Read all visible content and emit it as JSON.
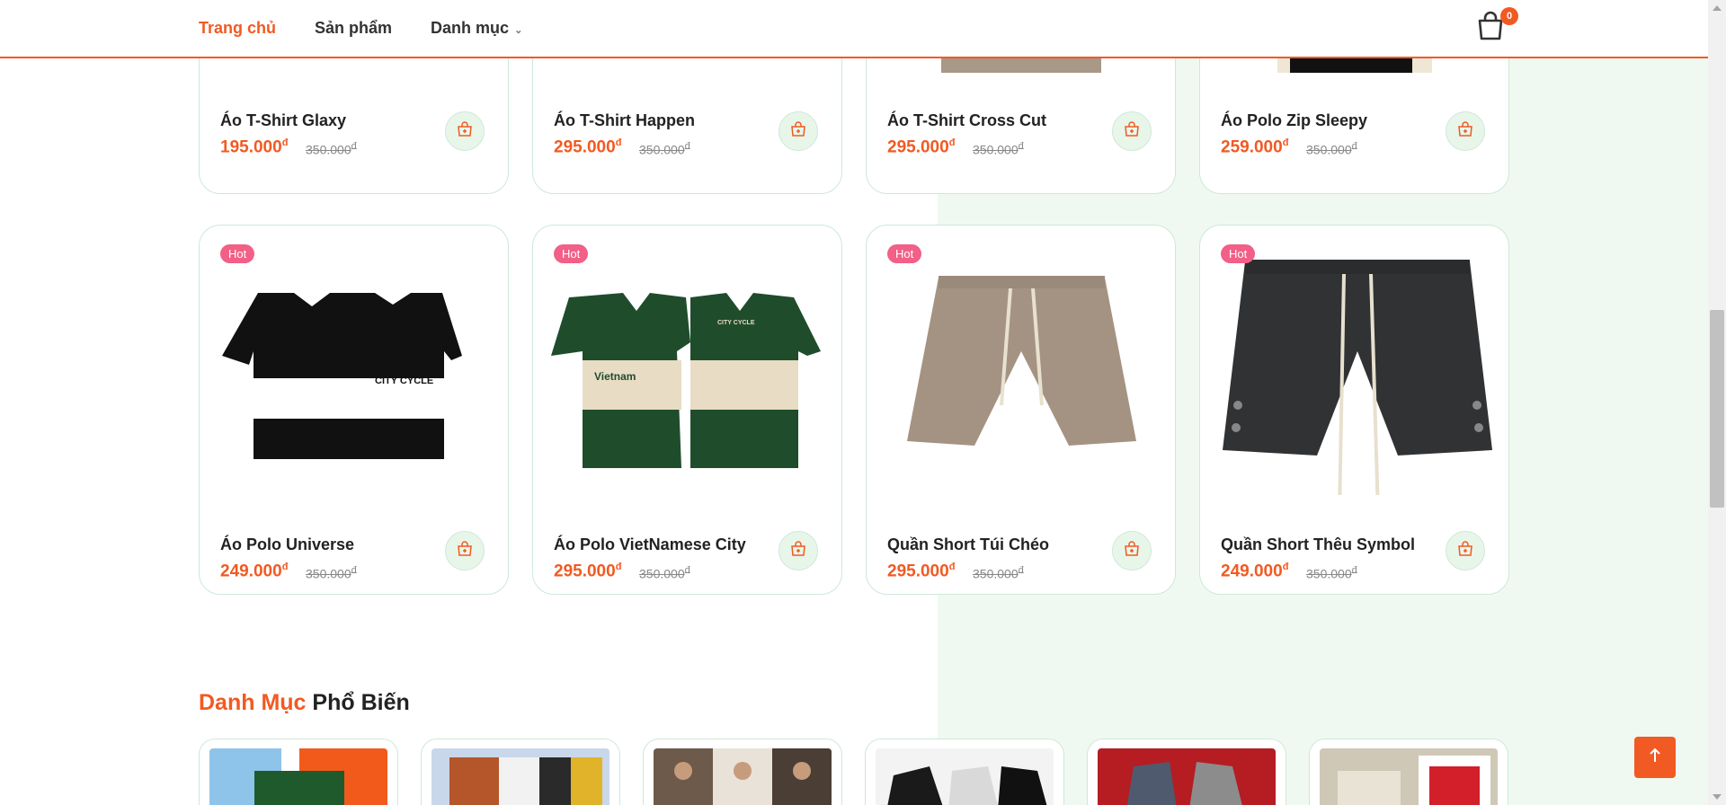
{
  "nav": {
    "items": [
      {
        "label": "Trang chủ",
        "active": true
      },
      {
        "label": "Sản phẩm",
        "active": false
      },
      {
        "label": "Danh mục",
        "active": false
      }
    ],
    "cart_count": "0"
  },
  "products_top": [
    {
      "name": "Áo T-Shirt Glaxy",
      "price": "195.000",
      "old_price": "350.000"
    },
    {
      "name": "Áo T-Shirt Happen",
      "price": "295.000",
      "old_price": "350.000"
    },
    {
      "name": "Áo T-Shirt Cross Cut",
      "price": "295.000",
      "old_price": "350.000"
    },
    {
      "name": "Áo Polo Zip Sleepy",
      "price": "259.000",
      "old_price": "350.000"
    }
  ],
  "products_bottom": [
    {
      "badge": "Hot",
      "name": "Áo Polo Universe",
      "price": "249.000",
      "old_price": "350.000"
    },
    {
      "badge": "Hot",
      "name": "Áo Polo VietNamese City",
      "price": "295.000",
      "old_price": "350.000"
    },
    {
      "badge": "Hot",
      "name": "Quần Short Túi Chéo",
      "price": "295.000",
      "old_price": "350.000"
    },
    {
      "badge": "Hot",
      "name": "Quần Short Thêu Symbol",
      "price": "249.000",
      "old_price": "350.000"
    }
  ],
  "currency": "đ",
  "section": {
    "title_accent": "Danh Mục",
    "title_rest": "Phổ Biến"
  },
  "colors": {
    "accent": "#f15a22",
    "hot_badge": "#f25f87",
    "card_border": "#cde8d9",
    "bg_green": "#f0f9f1"
  },
  "icons": {
    "cart": "shopping-bag-icon",
    "add_to_cart": "cart-plus-icon",
    "scroll_top": "arrow-up-icon"
  }
}
